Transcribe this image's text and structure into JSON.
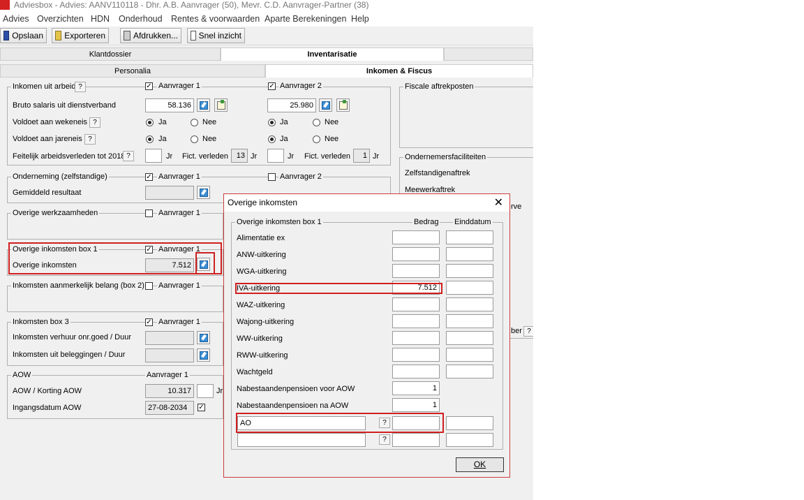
{
  "window": {
    "title": "Adviesbox - Advies: AANV110118 - Dhr. A.B. Aanvrager (50), Mevr. C.D. Aanvrager-Partner (38)"
  },
  "menu": [
    "Advies",
    "Overzichten",
    "HDN",
    "Onderhoud",
    "Rentes & voorwaarden",
    "Aparte Berekeningen",
    "Help"
  ],
  "toolbar": {
    "save": "Opslaan",
    "export": "Exporteren",
    "print": "Afdrukken...",
    "quick": "Snel inzicht"
  },
  "tabs_top": {
    "left": "Klantdossier",
    "active": "Inventarisatie"
  },
  "tabs_sub": {
    "left": "Personalia",
    "active": "Inkomen & Fiscus"
  },
  "q": "?",
  "labels": {
    "jr": "Jr",
    "fict": "Fict. verleden",
    "ja": "Ja",
    "nee": "Nee",
    "aanvrager1": "Aanvrager 1",
    "aanvrager2": "Aanvrager 2"
  },
  "arbeid": {
    "title": "Inkomen uit arbeid",
    "bruto": "Bruto salaris uit dienstverband",
    "wekeneis": "Voldoet aan wekeneis",
    "jareneis": "Voldoet aan jareneis",
    "feitelijk": "Feitelijk arbeidsverleden tot 2018",
    "bruto_a1": "58.136",
    "bruto_a2": "25.980",
    "fict_a1": "13",
    "fict_a2": "1"
  },
  "onderneming": {
    "title": "Onderneming (zelfstandige)",
    "resultaat": "Gemiddeld resultaat"
  },
  "overige_werk": {
    "title": "Overige werkzaamheden"
  },
  "overige_box1": {
    "title": "Overige inkomsten box 1",
    "label": "Overige inkomsten",
    "value": "7.512"
  },
  "aanmerkelijk": {
    "title": "Inkomsten aanmerkelijk belang (box 2)"
  },
  "box3": {
    "title": "Inkomsten box 3",
    "verhuur": "Inkomsten verhuur onr.goed / Duur",
    "beleggingen": "Inkomsten uit beleggingen / Duur"
  },
  "aow": {
    "title": "AOW",
    "header": "Aanvrager 1",
    "korting": "AOW / Korting AOW",
    "korting_value": "10.317",
    "ingang": "Ingangsdatum AOW",
    "ingang_value": "27-08-2034"
  },
  "fiscale": {
    "title": "Fiscale aftrekposten"
  },
  "ondernemers": {
    "title": "Ondernemersfaciliteiten",
    "items": [
      "Zelfstandigenaftrek",
      "Meewerkaftrek"
    ],
    "partial": "rve",
    "partial2": "ber"
  },
  "dialog": {
    "title": "Overige inkomsten",
    "group": "Overige inkomsten box 1",
    "col_bedrag": "Bedrag",
    "col_einddatum": "Einddatum",
    "rows": [
      {
        "label": "Alimentatie ex",
        "bedrag": ""
      },
      {
        "label": "ANW-uitkering",
        "bedrag": ""
      },
      {
        "label": "WGA-uitkering",
        "bedrag": ""
      },
      {
        "label": "IVA-uitkering",
        "bedrag": "7.512"
      },
      {
        "label": "WAZ-uitkering",
        "bedrag": ""
      },
      {
        "label": "Wajong-uitkering",
        "bedrag": ""
      },
      {
        "label": "WW-uitkering",
        "bedrag": ""
      },
      {
        "label": "RWW-uitkering",
        "bedrag": ""
      },
      {
        "label": "Wachtgeld",
        "bedrag": ""
      },
      {
        "label": "Nabestaandenpensioen voor AOW",
        "bedrag": "1"
      },
      {
        "label": "Nabestaandenpensioen na AOW",
        "bedrag": "1"
      }
    ],
    "custom_value": "AO",
    "ok": "OK"
  }
}
